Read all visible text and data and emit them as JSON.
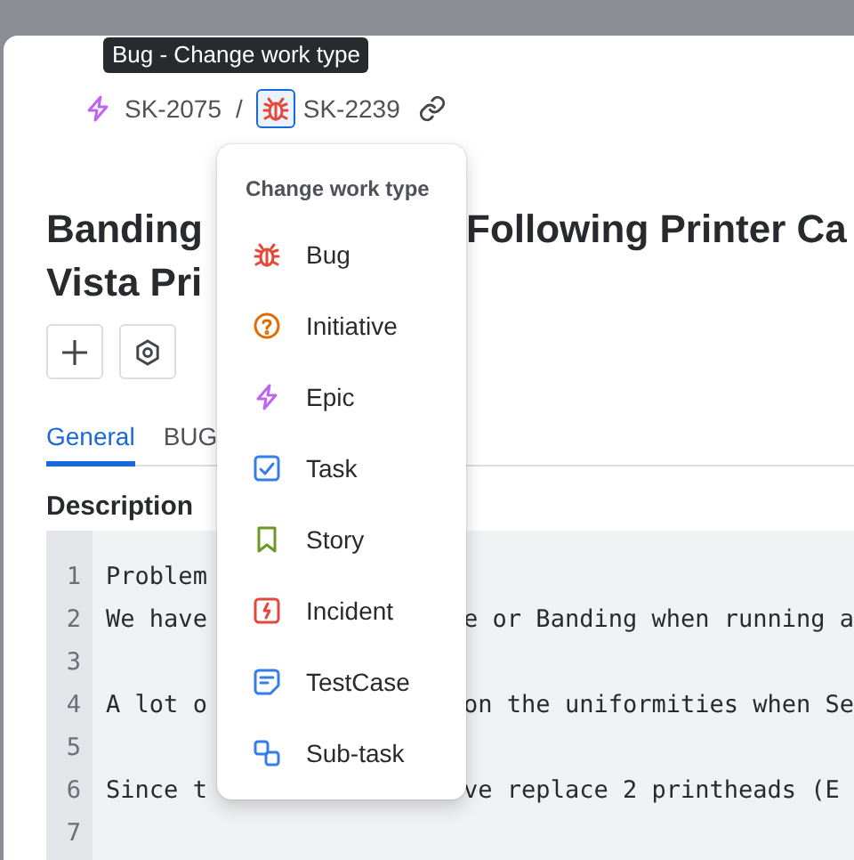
{
  "tooltip": {
    "text": "Bug - Change work type"
  },
  "breadcrumb": [
    {
      "kind": "epic",
      "key": "SK-2075"
    },
    {
      "kind": "bug",
      "key": "SK-2239",
      "selected": true
    }
  ],
  "breadcrumb_separator": "/",
  "title": {
    "lines": [
      {
        "left": "Banding",
        "right": "Following Printer Ca"
      },
      {
        "left": "Vista Pri"
      }
    ]
  },
  "tabs": [
    {
      "label": "General",
      "selected": true
    },
    {
      "label": "BUG",
      "selected": false
    }
  ],
  "description": {
    "heading": "Description",
    "lines": [
      {
        "number": "1",
        "left": "Problem"
      },
      {
        "number": "2",
        "left": "We have",
        "right": "e or Banding when running a"
      },
      {
        "number": "3"
      },
      {
        "number": "4",
        "left": "A lot o",
        "right": "on the uniformities when Se"
      },
      {
        "number": "5"
      },
      {
        "number": "6",
        "left": "Since t",
        "right": "ve replace 2 printheads (E"
      },
      {
        "number": "7"
      }
    ]
  },
  "menu": {
    "header": "Change work type",
    "items": [
      {
        "kind": "bug",
        "label": "Bug"
      },
      {
        "kind": "initiative",
        "label": "Initiative"
      },
      {
        "kind": "epic",
        "label": "Epic"
      },
      {
        "kind": "task",
        "label": "Task"
      },
      {
        "kind": "story",
        "label": "Story"
      },
      {
        "kind": "incident",
        "label": "Incident"
      },
      {
        "kind": "testcase",
        "label": "TestCase"
      },
      {
        "kind": "subtask",
        "label": "Sub-task"
      }
    ]
  }
}
